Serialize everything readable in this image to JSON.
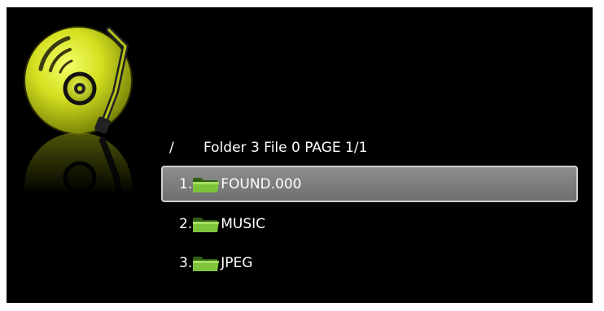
{
  "header": {
    "path": "/",
    "summary": "Folder 3 File 0 PAGE 1/1"
  },
  "logo": {
    "icon": "music-disc-icon",
    "color": "#d4e020"
  },
  "files": [
    {
      "index": "1.",
      "name": "FOUND.000",
      "icon": "folder-icon",
      "selected": true
    },
    {
      "index": "2.",
      "name": "MUSIC",
      "icon": "folder-icon",
      "selected": false
    },
    {
      "index": "3.",
      "name": "JPEG",
      "icon": "folder-icon",
      "selected": false
    }
  ],
  "colors": {
    "background": "#000000",
    "text": "#ffffff",
    "selection": "#7c7c7c",
    "folder": "#7ec43a"
  }
}
